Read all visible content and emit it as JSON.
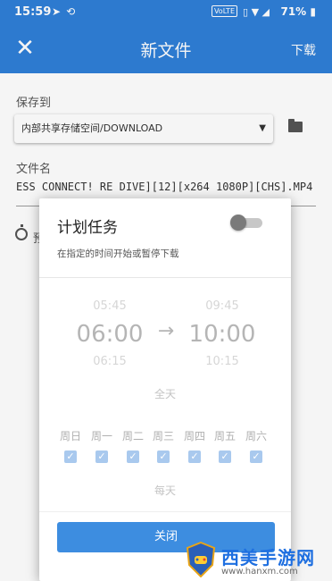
{
  "status_bar": {
    "time": "15:59",
    "left_icons": [
      "telegram-icon",
      "sync-icon"
    ],
    "volte_badge": "VoLTE",
    "right_icons": [
      "vibrate-icon",
      "wifi-icon",
      "signal-icon"
    ],
    "battery_text": "71%"
  },
  "app_bar": {
    "close_icon": "close-icon",
    "title": "新文件",
    "action_label": "下载"
  },
  "form": {
    "save_label": "保存到",
    "location_value": "内部共享存储空间/DOWNLOAD",
    "folder_icon": "folder-icon",
    "name_label": "文件名",
    "filename_value": "ESS CONNECT! RE DIVE][12][x264 1080P][CHS].MP4",
    "timer_icon": "timer-icon",
    "timer_label_partial": "预"
  },
  "dialog": {
    "title": "计划任务",
    "subtitle": "在指定的时间开始或暂停下载",
    "toggle_on": false,
    "start_time": {
      "prev": "05:45",
      "current": "06:00",
      "next": "06:15"
    },
    "arrow": "→",
    "end_time": {
      "prev": "09:45",
      "current": "10:00",
      "next": "10:15"
    },
    "all_day_label": "全天",
    "days": [
      {
        "label": "周日",
        "checked": true
      },
      {
        "label": "周一",
        "checked": true
      },
      {
        "label": "周二",
        "checked": true
      },
      {
        "label": "周三",
        "checked": true
      },
      {
        "label": "周四",
        "checked": true
      },
      {
        "label": "周五",
        "checked": true
      },
      {
        "label": "周六",
        "checked": true
      }
    ],
    "every_day_label": "每天",
    "close_button_label": "关闭"
  },
  "watermark": {
    "text": "西美手游网",
    "url": "www.hanxm.com"
  },
  "colors": {
    "primary": "#2f7fd8",
    "button": "#3d8de0",
    "checkbox_disabled": "#a9c9ee"
  }
}
